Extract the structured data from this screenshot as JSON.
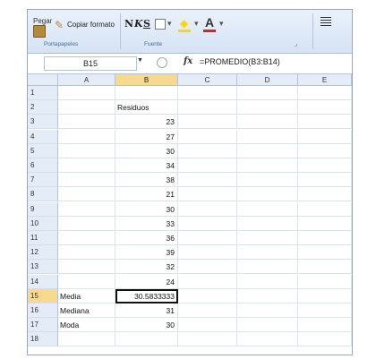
{
  "ribbon": {
    "paste_label": "Pegar",
    "copy_format_label": "Copiar formato",
    "clipboard_group": "Portapapeles",
    "bold": "N",
    "italic": "K",
    "underline": "S",
    "font_group": "Fuente"
  },
  "formula_bar": {
    "name_box": "B15",
    "fx_label": "fx",
    "formula": "=PROMEDIO(B3:B14)"
  },
  "columns": [
    "A",
    "B",
    "C",
    "D",
    "E"
  ],
  "active_column": "B",
  "active_row": "15",
  "rows": [
    {
      "n": "1",
      "a": "",
      "b": "",
      "b_num": false
    },
    {
      "n": "2",
      "a": "",
      "b": "Residuos",
      "b_num": false
    },
    {
      "n": "3",
      "a": "",
      "b": "23",
      "b_num": true
    },
    {
      "n": "4",
      "a": "",
      "b": "27",
      "b_num": true
    },
    {
      "n": "5",
      "a": "",
      "b": "30",
      "b_num": true
    },
    {
      "n": "6",
      "a": "",
      "b": "34",
      "b_num": true
    },
    {
      "n": "7",
      "a": "",
      "b": "38",
      "b_num": true
    },
    {
      "n": "8",
      "a": "",
      "b": "21",
      "b_num": true
    },
    {
      "n": "9",
      "a": "",
      "b": "30",
      "b_num": true
    },
    {
      "n": "10",
      "a": "",
      "b": "33",
      "b_num": true
    },
    {
      "n": "11",
      "a": "",
      "b": "36",
      "b_num": true
    },
    {
      "n": "12",
      "a": "",
      "b": "39",
      "b_num": true
    },
    {
      "n": "13",
      "a": "",
      "b": "32",
      "b_num": true
    },
    {
      "n": "14",
      "a": "",
      "b": "24",
      "b_num": true
    },
    {
      "n": "15",
      "a": "Media",
      "b": "30.5833333",
      "b_num": true,
      "selected": true
    },
    {
      "n": "16",
      "a": "Mediana",
      "b": "31",
      "b_num": true
    },
    {
      "n": "17",
      "a": "Moda",
      "b": "30",
      "b_num": true
    },
    {
      "n": "18",
      "a": "",
      "b": "",
      "b_num": false
    }
  ],
  "colors": {
    "ribbon_bg": "#dce7f5",
    "header_bg": "#e4ecf7",
    "active_header": "#f9d98d"
  }
}
